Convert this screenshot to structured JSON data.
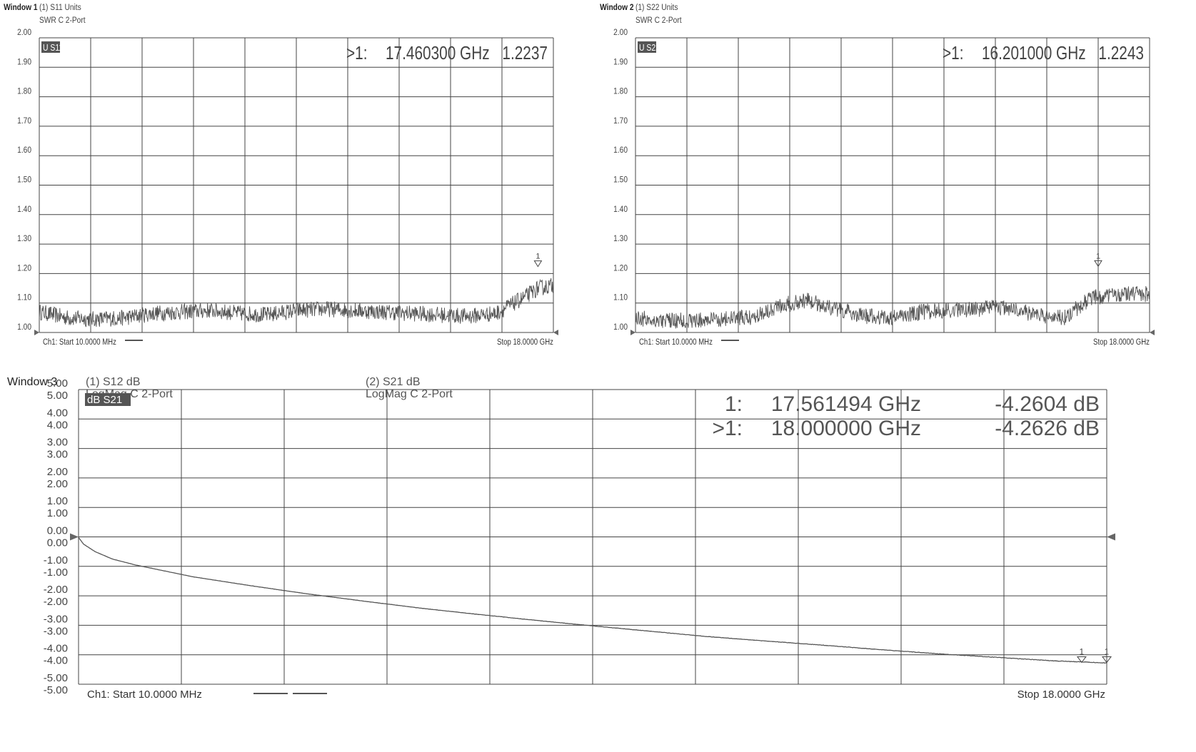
{
  "colors": {
    "trace": "#555555",
    "grid": "#444444",
    "label_bg": "#555555",
    "label_fg": "#ffffff"
  },
  "chart_data": [
    {
      "type": "line",
      "window_label": "Window 1",
      "header_lines": [
        "(1) S11 Units",
        "SWR C  2-Port"
      ],
      "trace_label": "U S11",
      "ylim": [
        1.0,
        2.0
      ],
      "yticks": [
        "2.00",
        "1.90",
        "1.80",
        "1.70",
        "1.60",
        "1.50",
        "1.40",
        "1.30",
        "1.20",
        "1.10",
        "1.00"
      ],
      "x_start_label": "Ch1: Start  10.0000 MHz",
      "x_stop_label": "Stop  18.0000 GHz",
      "x_range_ghz": [
        0.01,
        18.0
      ],
      "marker_readouts": [
        {
          "prefix": ">1:",
          "freq": "17.460300 GHz",
          "value": "1.2237"
        }
      ],
      "markers": [
        {
          "label": "1",
          "x_ghz": 17.4603,
          "y": 1.2237
        }
      ],
      "series": [
        {
          "x_ghz": [
            0.01,
            1,
            2,
            3,
            4,
            5,
            6,
            7,
            8,
            9,
            10,
            11,
            12,
            13,
            14,
            15,
            16,
            17,
            17.46,
            18
          ],
          "y": [
            1.07,
            1.05,
            1.045,
            1.05,
            1.065,
            1.07,
            1.075,
            1.065,
            1.06,
            1.075,
            1.08,
            1.075,
            1.07,
            1.065,
            1.06,
            1.055,
            1.065,
            1.12,
            1.15,
            1.16
          ]
        }
      ]
    },
    {
      "type": "line",
      "window_label": "Window 2",
      "header_lines": [
        "(1) S22 Units",
        "SWR C  2-Port"
      ],
      "trace_label": "U S22",
      "ylim": [
        1.0,
        2.0
      ],
      "yticks": [
        "2.00",
        "1.90",
        "1.80",
        "1.70",
        "1.60",
        "1.50",
        "1.40",
        "1.30",
        "1.20",
        "1.10",
        "1.00"
      ],
      "x_start_label": "Ch1: Start  10.0000 MHz",
      "x_stop_label": "Stop  18.0000 GHz",
      "x_range_ghz": [
        0.01,
        18.0
      ],
      "marker_readouts": [
        {
          "prefix": ">1:",
          "freq": "16.201000 GHz",
          "value": "1.2243"
        }
      ],
      "markers": [
        {
          "label": "1",
          "x_ghz": 16.201,
          "y": 1.2243
        }
      ],
      "series": [
        {
          "x_ghz": [
            0.01,
            1,
            2,
            3,
            4,
            5,
            6,
            7,
            8,
            9,
            10,
            11,
            12,
            13,
            14,
            15,
            16,
            17,
            18
          ],
          "y": [
            1.05,
            1.04,
            1.04,
            1.045,
            1.05,
            1.09,
            1.11,
            1.08,
            1.055,
            1.05,
            1.07,
            1.075,
            1.08,
            1.085,
            1.06,
            1.05,
            1.12,
            1.13,
            1.13
          ]
        }
      ]
    },
    {
      "type": "line",
      "window_label": "Window 3",
      "header_columns": [
        [
          "(1) S12 dB",
          "LogMag C  2-Port"
        ],
        [
          "(2) S21 dB",
          "LogMag C  2-Port"
        ]
      ],
      "trace_label": "dB S21",
      "ylim": [
        -5.0,
        5.0
      ],
      "yticks_pairs": [
        [
          "5.00",
          "5.00"
        ],
        [
          "4.00",
          "4.00"
        ],
        [
          "3.00",
          "3.00"
        ],
        [
          "2.00",
          "2.00"
        ],
        [
          "1.00",
          "1.00"
        ],
        [
          "0.00",
          "0.00"
        ],
        [
          "-1.00",
          "-1.00"
        ],
        [
          "-2.00",
          "-2.00"
        ],
        [
          "-3.00",
          "-3.00"
        ],
        [
          "-4.00",
          "-4.00"
        ],
        [
          "-5.00",
          "-5.00"
        ]
      ],
      "x_start_label": "Ch1: Start  10.0000 MHz",
      "x_stop_label": "Stop  18.0000 GHz",
      "x_range_ghz": [
        0.01,
        18.0
      ],
      "marker_readouts": [
        {
          "prefix": "1:",
          "freq": "17.561494 GHz",
          "value": "-4.2604 dB"
        },
        {
          "prefix": ">1:",
          "freq": "18.000000 GHz",
          "value": "-4.2626 dB"
        }
      ],
      "markers": [
        {
          "label": "1",
          "x_ghz": 17.561494,
          "y": -4.2604
        },
        {
          "label": "1",
          "x_ghz": 18.0,
          "y": -4.2626
        }
      ],
      "series": [
        {
          "name": "S21",
          "x_ghz": [
            0.01,
            0.1,
            0.3,
            0.6,
            1,
            1.5,
            2,
            3,
            4,
            5,
            6,
            7,
            8,
            9,
            10,
            11,
            12,
            13,
            14,
            15,
            16,
            17,
            18
          ],
          "y": [
            -0.02,
            -0.25,
            -0.5,
            -0.75,
            -0.95,
            -1.15,
            -1.35,
            -1.65,
            -1.93,
            -2.18,
            -2.42,
            -2.63,
            -2.83,
            -3.02,
            -3.2,
            -3.38,
            -3.53,
            -3.67,
            -3.82,
            -3.96,
            -4.08,
            -4.2,
            -4.28
          ]
        }
      ]
    }
  ]
}
